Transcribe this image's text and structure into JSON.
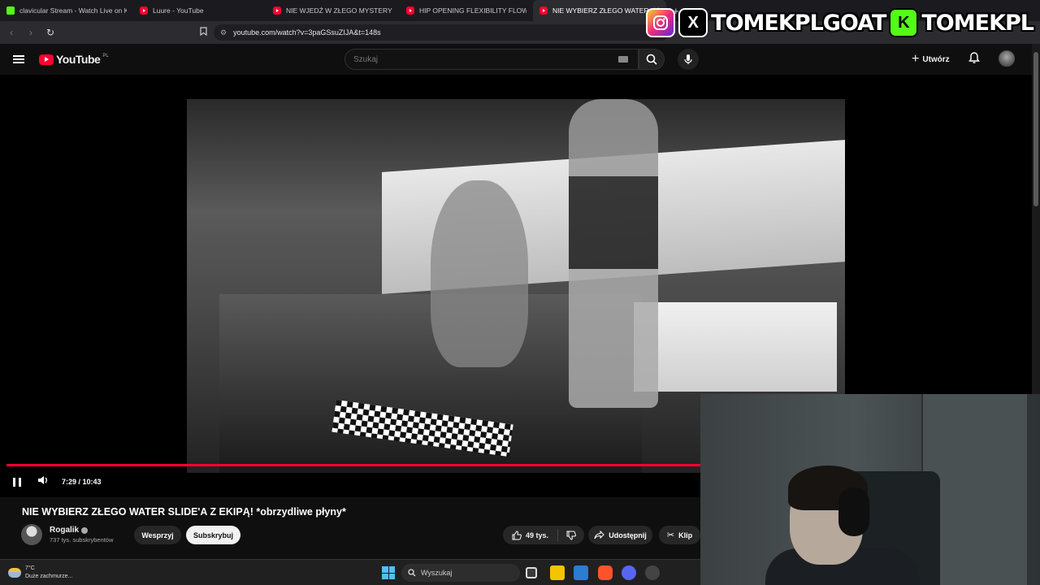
{
  "browser": {
    "tabs": [
      {
        "title": "clavicular Stream - Watch Live on Kick",
        "favicon": "kick-icon",
        "active": false
      },
      {
        "title": "Luure - YouTube",
        "favicon": "youtube-icon",
        "active": false
      },
      {
        "title": "NIE WJEDŹ W ZŁEGO MYSTERY BOX",
        "favicon": "youtube-icon",
        "active": false
      },
      {
        "title": "HIP OPENING FLEXIBILITY FLOW Dre",
        "favicon": "youtube-icon",
        "active": false
      },
      {
        "title": "NIE WYBIERZ ZŁEGO WATER",
        "favicon": "youtube-icon",
        "active": true
      }
    ],
    "url": "youtube.com/watch?v=3paGSsuZIJA&t=148s"
  },
  "overlay": {
    "handle1": "TOMEKPLGOAT",
    "handle2": "TOMEKPL",
    "kick_letter": "K",
    "x_letter": "X"
  },
  "youtube": {
    "logo_text": "YouTube",
    "logo_region": "PL",
    "search_placeholder": "Szukaj",
    "create_label": "Utwórz"
  },
  "player": {
    "time": "7:29 / 10:43",
    "progress_fraction": 0.7
  },
  "video": {
    "title": "NIE WYBIERZ ZŁEGO WATER SLIDE'A Z EKIPĄ! *obrzydliwe płyny*",
    "channel": "Rogalik",
    "subscribers": "737 tys. subskrybentów",
    "support_label": "Wesprzyj",
    "subscribe_label": "Subskrybuj",
    "likes": "49 tys.",
    "share_label": "Udostępnij",
    "clip_label": "Klip"
  },
  "taskbar": {
    "temp": "7°C",
    "weather": "Duże zachmurze...",
    "search_placeholder": "Wyszukaj"
  },
  "colors": {
    "yt_red": "#ff0033",
    "kick_green": "#53fc18",
    "bg": "#0f0f0f"
  }
}
